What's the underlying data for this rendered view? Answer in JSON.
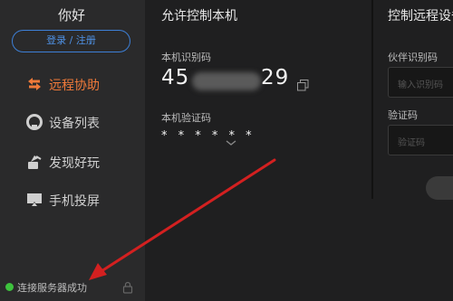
{
  "sidebar": {
    "user_name": "你好",
    "login_label": "登录 / 注册",
    "items": [
      {
        "label": "远程协助",
        "icon": "remote-assist-icon",
        "active": true
      },
      {
        "label": "设备列表",
        "icon": "device-list-icon",
        "active": false
      },
      {
        "label": "发现好玩",
        "icon": "discover-icon",
        "active": false
      },
      {
        "label": "手机投屏",
        "icon": "screen-cast-icon",
        "active": false
      }
    ],
    "status_text": "连接服务器成功",
    "status_color": "#3dc23d"
  },
  "allow_panel": {
    "title": "允许控制本机",
    "id_label": "本机识别码",
    "id_visible_start": "45",
    "id_visible_end": "29",
    "code_label": "本机验证码",
    "code_value": "* * * * * *"
  },
  "control_panel": {
    "title": "控制远程设备",
    "partner_id_label": "伙伴识别码",
    "partner_id_placeholder": "输入识别码",
    "code_label": "验证码",
    "code_placeholder": "验证码"
  },
  "colors": {
    "accent": "#f07a3a",
    "link_blue": "#3d7fd6",
    "annotation_arrow": "#d32020"
  }
}
